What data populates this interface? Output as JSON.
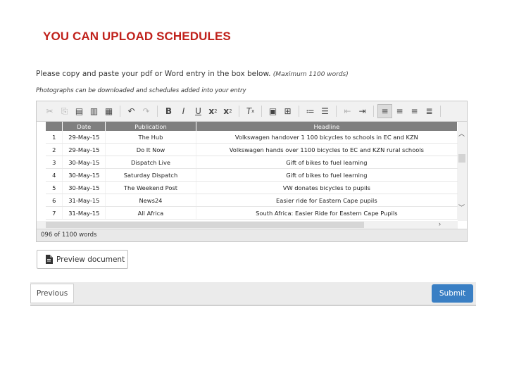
{
  "slide": {
    "title": "YOU CAN UPLOAD SCHEDULES"
  },
  "instructions": {
    "line1": "Please copy and paste your pdf or Word entry in the box below.",
    "line1_max": "(Maximum 1100 words)",
    "line2": "Photographs can be downloaded and schedules added into your entry"
  },
  "toolbar": {
    "buttons": [
      {
        "name": "cut-icon",
        "glyph": "✂",
        "disabled": true
      },
      {
        "name": "copy-icon",
        "glyph": "⎘",
        "disabled": true
      },
      {
        "name": "paste-icon",
        "glyph": "📋",
        "disabled": false
      },
      {
        "name": "paste-text-icon",
        "glyph": "▤",
        "disabled": false
      },
      {
        "name": "paste-word-icon",
        "glyph": "▥",
        "disabled": false
      },
      {
        "name": "undo-icon",
        "glyph": "↶",
        "disabled": false
      },
      {
        "name": "redo-icon",
        "glyph": "↷",
        "disabled": true
      },
      {
        "name": "bold-icon",
        "glyph": "B",
        "disabled": false
      },
      {
        "name": "italic-icon",
        "glyph": "I",
        "disabled": false
      },
      {
        "name": "underline-icon",
        "glyph": "U",
        "disabled": false
      },
      {
        "name": "subscript-icon",
        "glyph": "x₂",
        "disabled": false
      },
      {
        "name": "superscript-icon",
        "glyph": "x²",
        "disabled": false
      },
      {
        "name": "remove-format-icon",
        "glyph": "Tx",
        "disabled": false
      },
      {
        "name": "image-icon",
        "glyph": "▣",
        "disabled": false
      },
      {
        "name": "table-icon",
        "glyph": "⊞",
        "disabled": false
      },
      {
        "name": "numbered-list-icon",
        "glyph": "≔",
        "disabled": false
      },
      {
        "name": "bulleted-list-icon",
        "glyph": "☰",
        "disabled": false
      },
      {
        "name": "decrease-indent-icon",
        "glyph": "⇤",
        "disabled": true
      },
      {
        "name": "increase-indent-icon",
        "glyph": "⇥",
        "disabled": false
      },
      {
        "name": "align-left-icon",
        "glyph": "≡",
        "disabled": false,
        "active": true
      },
      {
        "name": "align-center-icon",
        "glyph": "≡",
        "disabled": false
      },
      {
        "name": "align-right-icon",
        "glyph": "≡",
        "disabled": false
      },
      {
        "name": "justify-icon",
        "glyph": "≡",
        "disabled": false
      }
    ]
  },
  "table": {
    "headers": [
      "",
      "Date",
      "Publication",
      "Headline"
    ],
    "rows": [
      [
        "1",
        "29-May-15",
        "The Hub",
        "Volkswagen handover 1 100 bicycles to schools in EC and KZN"
      ],
      [
        "2",
        "29-May-15",
        "Do It Now",
        "Volkswagen hands over 1100 bicycles to EC and KZN rural schools"
      ],
      [
        "3",
        "30-May-15",
        "Dispatch Live",
        "Gift of bikes to fuel learning"
      ],
      [
        "4",
        "30-May-15",
        "Saturday Dispatch",
        "Gift of bikes to fuel learning"
      ],
      [
        "5",
        "30-May-15",
        "The Weekend Post",
        "VW donates bicycles to pupils"
      ],
      [
        "6",
        "31-May-15",
        "News24",
        "Easier ride for Eastern Cape pupils"
      ],
      [
        "7",
        "31-May-15",
        "All Africa",
        "South Africa: Easier Ride for Eastern Cape Pupils"
      ]
    ]
  },
  "editor": {
    "word_count": "096 of 1100 words"
  },
  "buttons": {
    "preview": "Preview document",
    "previous": "Previous",
    "submit": "Submit"
  }
}
